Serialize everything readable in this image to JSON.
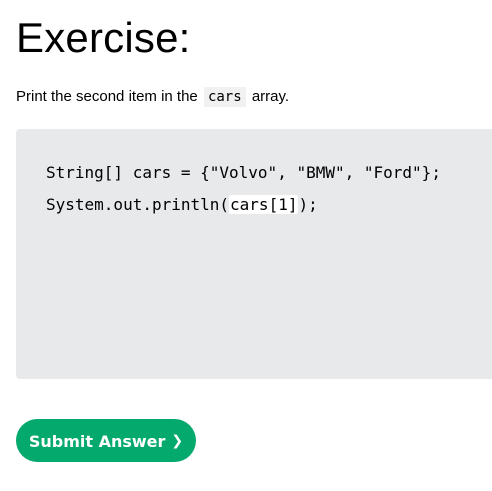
{
  "exercise": {
    "title": "Exercise:",
    "instruction_before": "Print the second item in the",
    "instruction_code": "cars",
    "instruction_after": "array."
  },
  "code": {
    "line1": "String[] cars = {\"Volvo\", \"BMW\", \"Ford\"};",
    "line2_prefix": "System.out.println(",
    "line2_input": "cars[1]",
    "line2_suffix": ");"
  },
  "submit": {
    "label": "Submit Answer",
    "arrow": "❯"
  },
  "colors": {
    "accent": "#04aa6d",
    "code_background": "#e7e9eb",
    "inline_code_background": "#f1f1f1"
  }
}
